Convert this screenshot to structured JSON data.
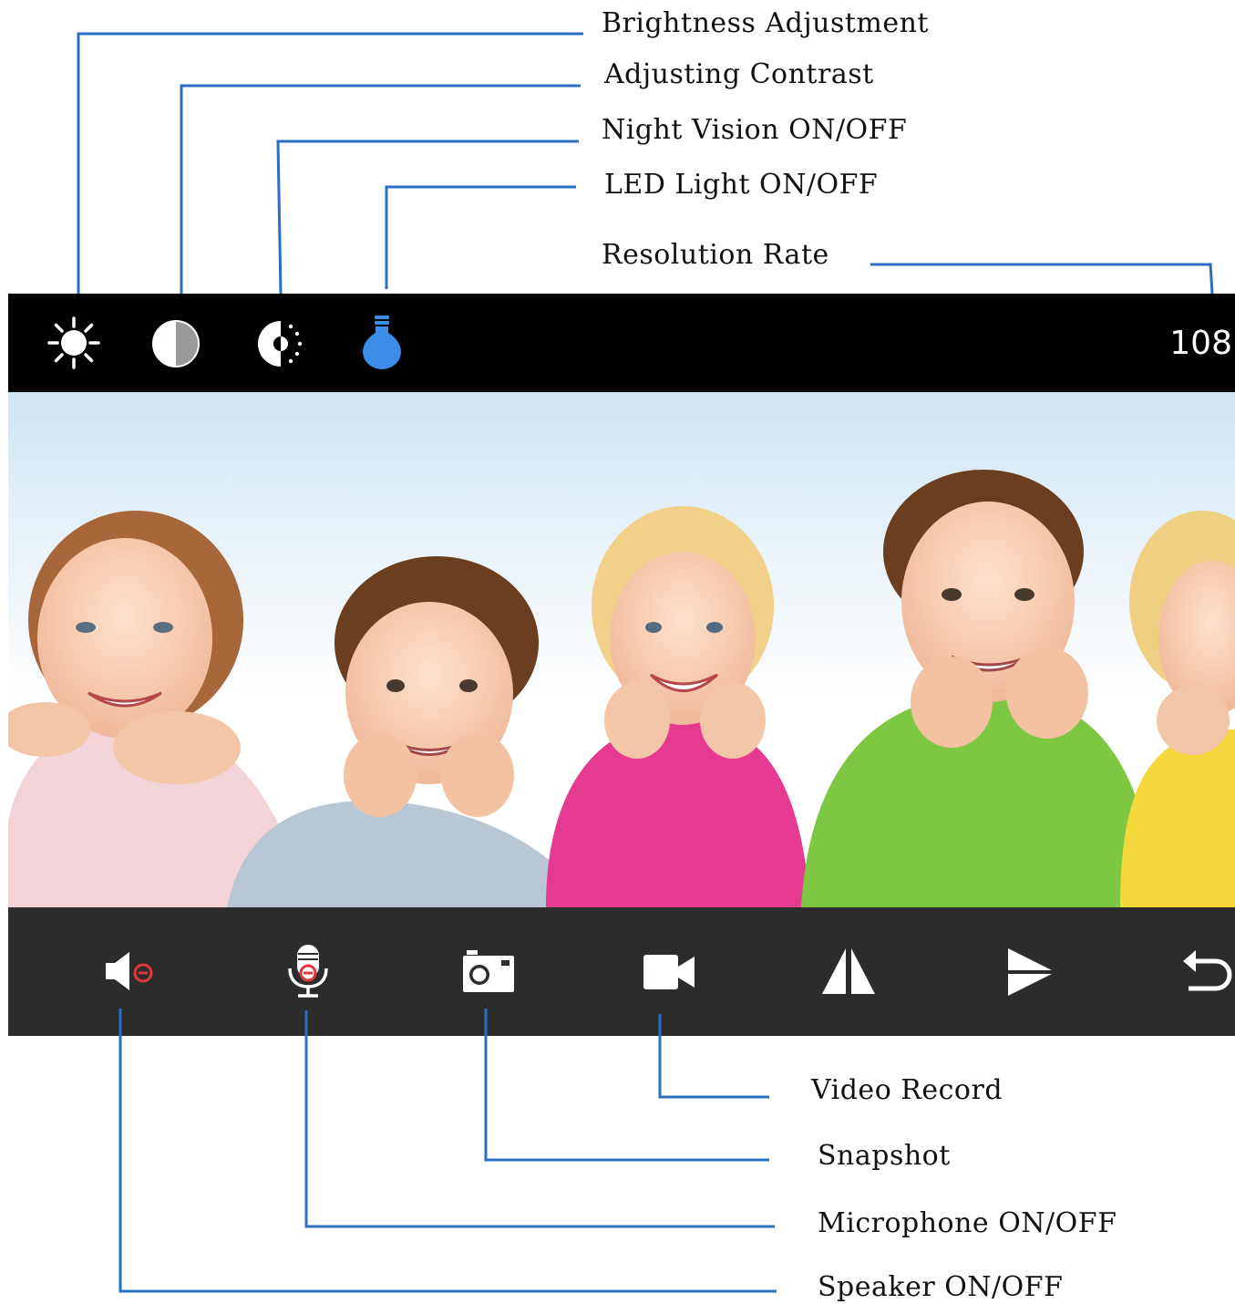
{
  "top_callouts": {
    "brightness": "Brightness Adjustment",
    "contrast": "Adjusting Contrast",
    "night_vision": "Night Vision ON/OFF",
    "led_light": "LED Light ON/OFF",
    "resolution": "Resolution Rate"
  },
  "bottom_callouts": {
    "video_record": "Video Record",
    "snapshot": "Snapshot",
    "microphone": "Microphone ON/OFF",
    "speaker": "Speaker ON/OFF"
  },
  "toolbar": {
    "resolution_value": "108",
    "icons": [
      "sun-icon",
      "contrast-icon",
      "night-vision-icon",
      "bulb-icon"
    ]
  },
  "controls": {
    "icons": [
      "speaker-muted-icon",
      "microphone-muted-icon",
      "camera-icon",
      "video-camera-icon",
      "flip-vertical-icon",
      "flip-horizontal-icon",
      "back-icon"
    ]
  },
  "colors": {
    "callout_line": "#2b6fc2",
    "led_active": "#3b8de6",
    "mute_red": "#e0363c",
    "topbar": "#000000",
    "bottombar": "#2c2c2c"
  }
}
